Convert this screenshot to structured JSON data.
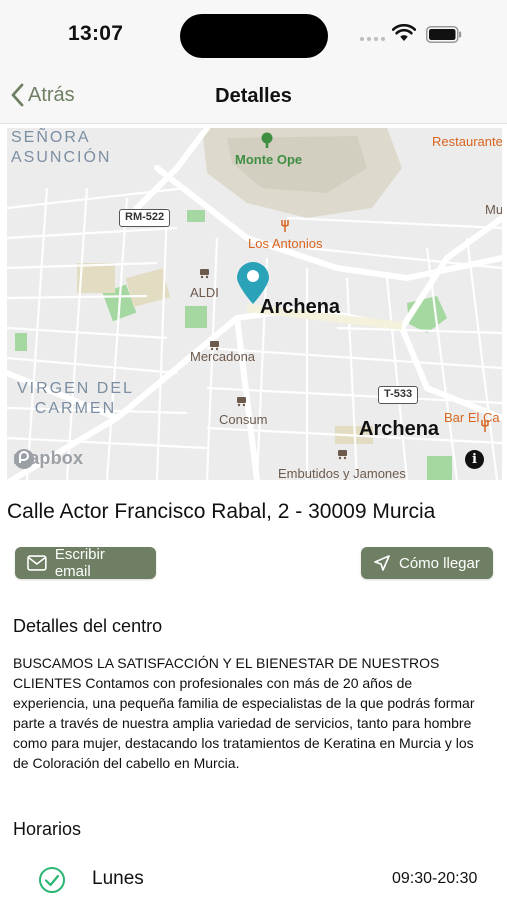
{
  "status_bar": {
    "time": "13:07"
  },
  "nav": {
    "back_label": "Atrás",
    "title": "Detalles"
  },
  "map": {
    "labels": {
      "district_1": [
        "SEÑORA",
        "ASUNCIÓN"
      ],
      "district_2": [
        "VIRGEN DEL",
        "CARMEN"
      ],
      "monte": "Monte Ope",
      "restaurante": "Restaurante",
      "mu": "Mu",
      "los_antonios": "Los Antonios",
      "aldi": "ALDI",
      "archena_main": "Archena",
      "archena_second": "Archena",
      "mercadona": "Mercadona",
      "consum": "Consum",
      "bar": "Bar El Ca",
      "embutidos": "Embutidos y Jamones",
      "rm": "RM-522",
      "t": "T-533",
      "mapbox": "mapbox",
      "info": "i"
    },
    "colors": {
      "pin": "#2aa3b8",
      "park": "#9fd59a",
      "water_area": "#d9d5c6"
    }
  },
  "address": "Calle Actor Francisco Rabal, 2 - 30009 Murcia",
  "actions": {
    "email_label": "Escribir email",
    "route_label": "Cómo llegar"
  },
  "details": {
    "title": "Detalles del centro",
    "text": "BUSCAMOS LA SATISFACCIÓN Y EL BIENESTAR DE NUESTROS CLIENTES  Contamos con profesionales con más de 20 años de experiencia, una pequeña familia de especialistas de la que podrás formar parte a través de nuestra amplia variedad de servicios, tanto para hombre como para mujer, destacando los tratamientos de Keratina en Murcia y los de Coloración del cabello en Murcia."
  },
  "schedule": {
    "title": "Horarios",
    "rows": [
      {
        "day": "Lunes",
        "hours": "09:30-20:30"
      }
    ]
  },
  "theme": {
    "accent": "#6f7f63",
    "check": "#2bb673"
  }
}
